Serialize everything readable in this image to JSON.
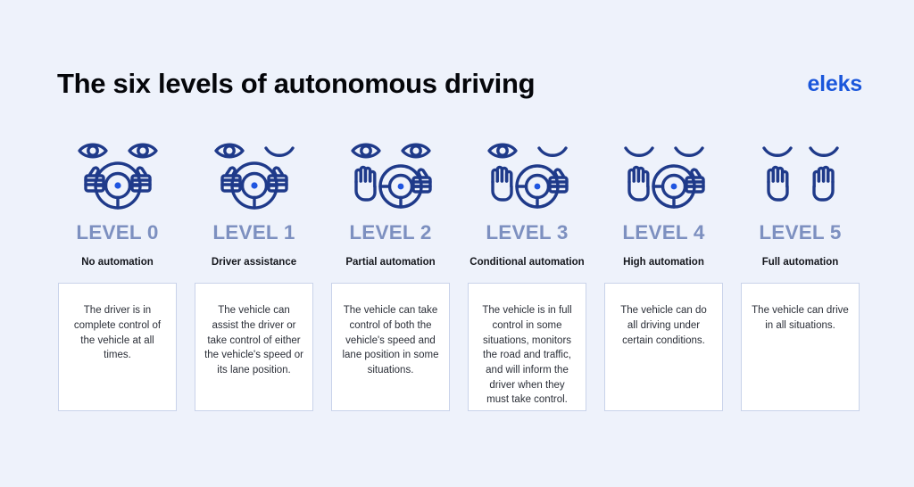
{
  "header": {
    "title": "The six levels of autonomous driving",
    "logo": "eleks"
  },
  "theme": {
    "background": "#eef2fb",
    "icon_stroke": "#1f3a8a",
    "icon_accent": "#1f55e0",
    "level_label_color": "#7d90c0",
    "card_background": "#ffffff",
    "card_border": "#c9d3ea",
    "logo_color": "#1a56db",
    "title_color": "#05060a"
  },
  "levels": [
    {
      "label": "LEVEL 0",
      "name": "No automation",
      "description": "The driver is in complete control of the vehicle at all times.",
      "icon": "eyes-open-both-hands-on-wheel-icon"
    },
    {
      "label": "LEVEL 1",
      "name": "Driver assistance",
      "description": "The vehicle can assist the driver or take control of either the vehicle's speed or its lane position.",
      "icon": "one-eye-open-both-hands-on-wheel-icon"
    },
    {
      "label": "LEVEL 2",
      "name": "Partial automation",
      "description": "The vehicle can take control of both the vehicle's speed and lane position in some situations.",
      "icon": "eyes-open-one-hand-off-wheel-icon"
    },
    {
      "label": "LEVEL 3",
      "name": "Conditional automation",
      "description": "The vehicle is in full control in some situations, monitors the road and traffic, and will inform the driver when they must take control.",
      "icon": "one-eye-open-one-hand-off-wheel-icon"
    },
    {
      "label": "LEVEL 4",
      "name": "High automation",
      "description": "The vehicle can do all driving under certain conditions.",
      "icon": "eyes-closed-one-hand-off-wheel-icon"
    },
    {
      "label": "LEVEL 5",
      "name": "Full automation",
      "description": "The vehicle can drive in all situations.",
      "icon": "eyes-closed-both-hands-off-icon"
    }
  ]
}
